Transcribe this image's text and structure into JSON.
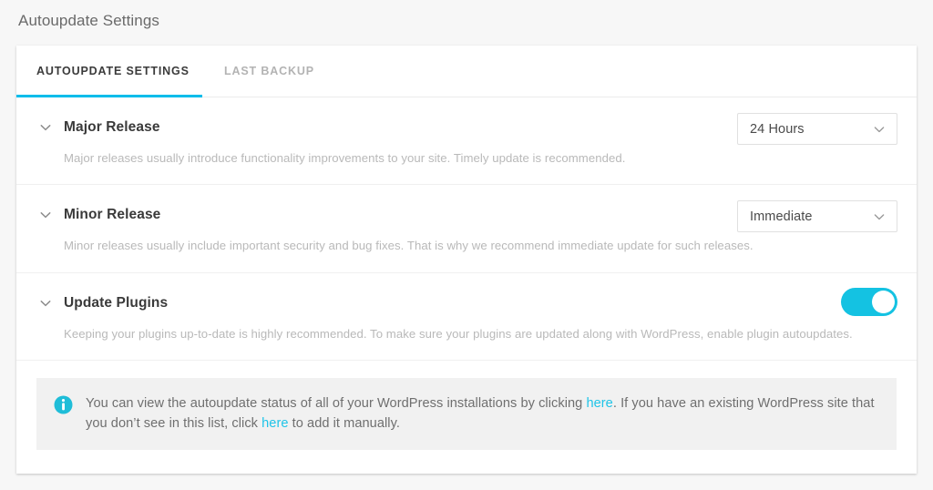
{
  "page": {
    "title": "Autoupdate Settings"
  },
  "tabs": [
    {
      "label": "AUTOUPDATE SETTINGS",
      "active": true
    },
    {
      "label": "LAST BACKUP",
      "active": false
    }
  ],
  "settings": {
    "major_release": {
      "title": "Major Release",
      "description": "Major releases usually introduce functionality improvements to your site. Timely update is recommended.",
      "control": "select",
      "value": "24 Hours"
    },
    "minor_release": {
      "title": "Minor Release",
      "description": "Minor releases usually include important security and bug fixes. That is why we recommend immediate update for such releases.",
      "control": "select",
      "value": "Immediate"
    },
    "update_plugins": {
      "title": "Update Plugins",
      "description": "Keeping your plugins up-to-date is highly recommended. To make sure your plugins are updated along with WordPress, enable plugin autoupdates.",
      "control": "toggle",
      "value": "on"
    }
  },
  "notice": {
    "icon": "info-icon",
    "text_part_1": "You can view the autoupdate status of all of your WordPress installations by clicking ",
    "link_1": "here",
    "text_part_2": ". If you have an existing WordPress site that you don’t see in this list, click ",
    "link_2": "here",
    "text_part_3": " to add it manually."
  },
  "colors": {
    "accent": "#00bcea",
    "toggle_on": "#14c2e2",
    "link": "#20c4e8",
    "page_bg": "#f7f7f7",
    "card_bg": "#ffffff",
    "notice_bg": "#f1f1f1"
  }
}
